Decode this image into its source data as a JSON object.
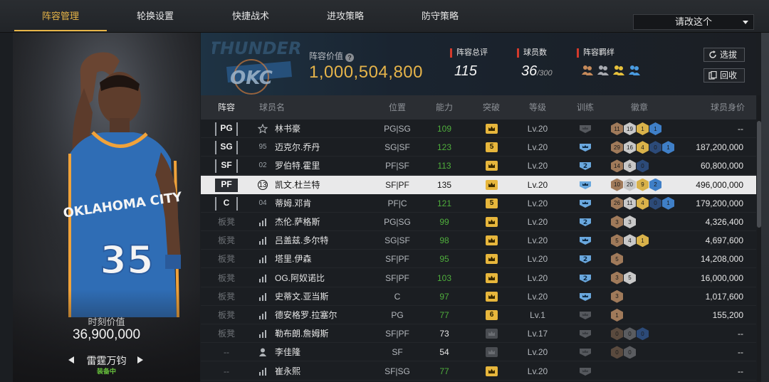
{
  "nav": {
    "tabs": [
      "阵容管理",
      "轮换设置",
      "快捷战术",
      "进攻策略",
      "防守策略"
    ],
    "active_tab": "阵容管理",
    "dropdown_label": "请改这个"
  },
  "player_card": {
    "team_text": "OKLAHOMA CITY",
    "jersey_number": "35",
    "moment_label": "时刻价值",
    "moment_value": "36,900,000",
    "card_name": "雷霆万钧",
    "equipped": "装备中"
  },
  "header": {
    "team_logo_text": "OKC",
    "team_logo_subtext": "THUNDER",
    "value_label": "阵容价值",
    "value": "1,000,504,800",
    "rating_label": "阵容总评",
    "rating_value": "115",
    "count_label": "球员数",
    "count_value": "36",
    "count_max": "/300",
    "bond_label": "阵容羁绊",
    "select_button": "选拔",
    "recycle_button": "回收",
    "bond_colors": [
      "#c58a5a",
      "#a8aab0",
      "#e7c13c",
      "#4a9be0"
    ]
  },
  "table": {
    "headers": [
      "阵容",
      "球员名",
      "位置",
      "能力",
      "突破",
      "等级",
      "训练",
      "徽章",
      "球员身价"
    ],
    "rows": [
      {
        "slot": "PG",
        "num": "",
        "icon": "star",
        "name": "林书豪",
        "pos": "PG|SG",
        "ability": "109",
        "green": true,
        "brk": "",
        "brk_color": "gold",
        "level": "Lv.20",
        "train": "grey",
        "badges": [
          [
            "11",
            "#a07a5a"
          ],
          [
            "19",
            "#c8c8c8"
          ],
          [
            "1",
            "#d9b24a"
          ],
          [
            "1",
            "#3f7fc7"
          ]
        ],
        "value": "--"
      },
      {
        "slot": "SG",
        "num": "95",
        "icon": "",
        "name": "迈克尔.乔丹",
        "pos": "SG|SF",
        "ability": "123",
        "green": true,
        "brk": "5",
        "brk_color": "gold",
        "level": "Lv.20",
        "train": "blue",
        "badges": [
          [
            "29",
            "#a07a5a"
          ],
          [
            "16",
            "#c8c8c8"
          ],
          [
            "4",
            "#d9b24a"
          ],
          [
            "0",
            "#2c4a78"
          ],
          [
            "1",
            "#3f7fc7"
          ]
        ],
        "value": "187,200,000"
      },
      {
        "slot": "SF",
        "num": "02",
        "icon": "",
        "name": "罗伯特.霍里",
        "pos": "PF|SF",
        "ability": "113",
        "green": true,
        "brk": "",
        "brk_color": "gold",
        "level": "Lv.20",
        "train": "blue2",
        "badges": [
          [
            "14",
            "#a07a5a"
          ],
          [
            "6",
            "#c8c8c8"
          ],
          [
            "0",
            "#2c4a78"
          ]
        ],
        "value": "60,800,000"
      },
      {
        "slot": "PF",
        "num": "13",
        "icon": "circle",
        "name": "凯文.杜兰特",
        "pos": "SF|PF",
        "ability": "135",
        "green": false,
        "brk": "",
        "brk_color": "gold",
        "level": "Lv.20",
        "train": "blue",
        "badges": [
          [
            "10",
            "#a07a5a"
          ],
          [
            "20",
            "#c8c8c8"
          ],
          [
            "9",
            "#d9b24a"
          ],
          [
            "2",
            "#3f7fc7"
          ]
        ],
        "value": "496,000,000",
        "selected": true
      },
      {
        "slot": "C",
        "num": "04",
        "icon": "",
        "name": "蒂姆.邓肯",
        "pos": "PF|C",
        "ability": "121",
        "green": true,
        "brk": "5",
        "brk_color": "gold",
        "level": "Lv.20",
        "train": "blue",
        "badges": [
          [
            "26",
            "#a07a5a"
          ],
          [
            "11",
            "#c8c8c8"
          ],
          [
            "4",
            "#d9b24a"
          ],
          [
            "0",
            "#2c4a78"
          ],
          [
            "1",
            "#3f7fc7"
          ]
        ],
        "value": "179,200,000"
      },
      {
        "slot": "板凳",
        "num": "",
        "icon": "bars",
        "name": "杰伦.萨格斯",
        "pos": "PG|SG",
        "ability": "99",
        "green": true,
        "brk": "",
        "brk_color": "gold",
        "level": "Lv.20",
        "train": "blue2",
        "badges": [
          [
            "3",
            "#a07a5a"
          ],
          [
            "3",
            "#c8c8c8"
          ]
        ],
        "value": "4,326,400"
      },
      {
        "slot": "板凳",
        "num": "",
        "icon": "bars",
        "name": "吕盖兹.多尔特",
        "pos": "SG|SF",
        "ability": "98",
        "green": true,
        "brk": "",
        "brk_color": "gold",
        "level": "Lv.20",
        "train": "blue",
        "badges": [
          [
            "5",
            "#a07a5a"
          ],
          [
            "4",
            "#c8c8c8"
          ],
          [
            "1",
            "#d9b24a"
          ]
        ],
        "value": "4,697,600"
      },
      {
        "slot": "板凳",
        "num": "",
        "icon": "bars",
        "name": "塔里.伊森",
        "pos": "SF|PF",
        "ability": "95",
        "green": true,
        "brk": "",
        "brk_color": "gold",
        "level": "Lv.20",
        "train": "blue2",
        "badges": [
          [
            "5",
            "#a07a5a"
          ]
        ],
        "value": "14,208,000"
      },
      {
        "slot": "板凳",
        "num": "",
        "icon": "bars",
        "name": "OG.阿奴诺比",
        "pos": "SF|PF",
        "ability": "103",
        "green": true,
        "brk": "",
        "brk_color": "gold",
        "level": "Lv.20",
        "train": "blue2",
        "badges": [
          [
            "3",
            "#a07a5a"
          ],
          [
            "5",
            "#c8c8c8"
          ]
        ],
        "value": "16,000,000"
      },
      {
        "slot": "板凳",
        "num": "",
        "icon": "bars",
        "name": "史蒂文.亚当斯",
        "pos": "C",
        "ability": "97",
        "green": true,
        "brk": "",
        "brk_color": "gold",
        "level": "Lv.20",
        "train": "blue",
        "badges": [
          [
            "3",
            "#a07a5a"
          ]
        ],
        "value": "1,017,600"
      },
      {
        "slot": "板凳",
        "num": "",
        "icon": "bars",
        "name": "德安格罗.拉塞尔",
        "pos": "PG",
        "ability": "77",
        "green": true,
        "brk": "6",
        "brk_color": "gold",
        "level": "Lv.1",
        "train": "grey",
        "badges": [
          [
            "1",
            "#a07a5a"
          ]
        ],
        "value": "155,200"
      },
      {
        "slot": "板凳",
        "num": "",
        "icon": "bars",
        "name": "勒布朗.詹姆斯",
        "pos": "SF|PF",
        "ability": "73",
        "green": false,
        "brk": "",
        "brk_color": "grey",
        "level": "Lv.17",
        "train": "grey",
        "badges": [
          [
            "0",
            "#5a4a3e"
          ],
          [
            "0",
            "#5a5c60"
          ],
          [
            "0",
            "#2c4a78"
          ]
        ],
        "value": "--"
      },
      {
        "slot": "--",
        "num": "",
        "icon": "person",
        "name": "李佳隆",
        "pos": "SF",
        "ability": "54",
        "green": false,
        "brk": "",
        "brk_color": "grey",
        "level": "Lv.20",
        "train": "grey",
        "badges": [
          [
            "0",
            "#5a4a3e"
          ],
          [
            "0",
            "#5a5c60"
          ]
        ],
        "value": "--"
      },
      {
        "slot": "--",
        "num": "",
        "icon": "bars",
        "name": "崔永熙",
        "pos": "SF|SG",
        "ability": "77",
        "green": true,
        "brk": "",
        "brk_color": "gold",
        "level": "Lv.20",
        "train": "grey",
        "badges": [],
        "value": "--"
      }
    ]
  }
}
